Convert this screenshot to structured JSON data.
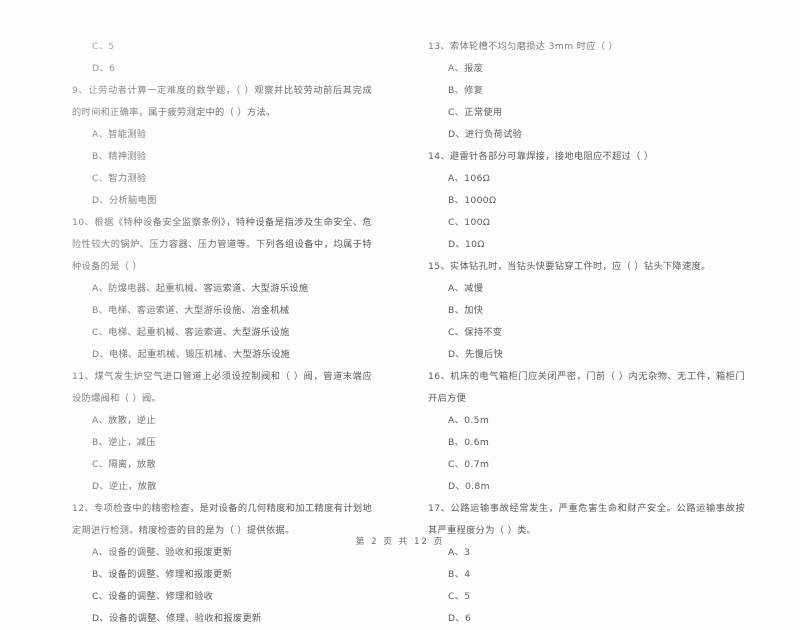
{
  "document": {
    "page_footer": "第 2 页 共 12 页"
  },
  "left_column": {
    "orphan_options": [
      "C、5",
      "D、6"
    ],
    "questions": [
      {
        "stem": "9、让劳动者计算一定难度的数学题，（        ）观察并比较劳动前后其完成的时间和正确率，属于疲劳测定中的（    ）方法。",
        "options": [
          "A、智能测验",
          "B、精神测验",
          "C、智力测验",
          "D、分析脑电图"
        ]
      },
      {
        "stem": "10、根据《特种设备安全监察条例》，特种设备是指涉及生命安全、危险性较大的锅炉、压力容器、压力管道等。下列各组设备中，均属于特种设备的是（     ）",
        "options": [
          "A、防爆电器、起重机械、客运索道、大型游乐设施",
          "B、电梯、客运索道、大型游乐设施、冶金机械",
          "C、电梯、起重机械、客运索道、大型游乐设施",
          "D、电梯、起重机械、锻压机械、大型游乐设施"
        ]
      },
      {
        "stem": "11、煤气发生炉空气进口管道上必须设控制阀和（    ）阀，管道末端应设防爆阀和（      ）阀。",
        "options": [
          "A、放散，逆止",
          "B、逆止，减压",
          "C、隔离，放散",
          "D、逆止，放散"
        ]
      },
      {
        "stem": "12、专项检查中的精密检查，是对设备的几何精度和加工精度有计划地定期进行检测。精度检查的目的是为（    ）提供依据。",
        "options": [
          "A、设备的调整、验收和报废更新",
          "B、设备的调整、修理和报废更新",
          "C、设备的调整、修理和验收",
          "D、设备的调整、修理、验收和报废更新"
        ]
      }
    ]
  },
  "right_column": {
    "questions": [
      {
        "stem": "13、索体轮槽不均匀磨损达 3mm 时应（      ）",
        "options": [
          "A、报废",
          "B、修复",
          "C、正常使用",
          "D、进行负荷试验"
        ]
      },
      {
        "stem": "14、避雷针各部分可靠焊接，接地电阻应不超过（      ）",
        "options": [
          "A、106Ω",
          "B、1000Ω",
          "C、100Ω",
          "D、10Ω"
        ]
      },
      {
        "stem": "15、实体钻孔时，当钻头快要钻穿工件时，应（      ）钻头下降速度。",
        "options": [
          "A、减慢",
          "B、加快",
          "C、保持不变",
          "D、先慢后快"
        ]
      },
      {
        "stem": "16、机床的电气箱柜门应关闭严密，门前（      ）内无杂物、无工件，箱柜门开启方便",
        "options": [
          "A、0.5m",
          "B、0.6m",
          "C、0.7m",
          "D、0.8m"
        ]
      },
      {
        "stem": "17、公路运输事故经常发生，严重危害生命和财产安全。公路运输事故按其严重程度分为（    ）类。",
        "options": [
          "A、3",
          "B、4",
          "C、5",
          "D、6"
        ]
      }
    ]
  }
}
